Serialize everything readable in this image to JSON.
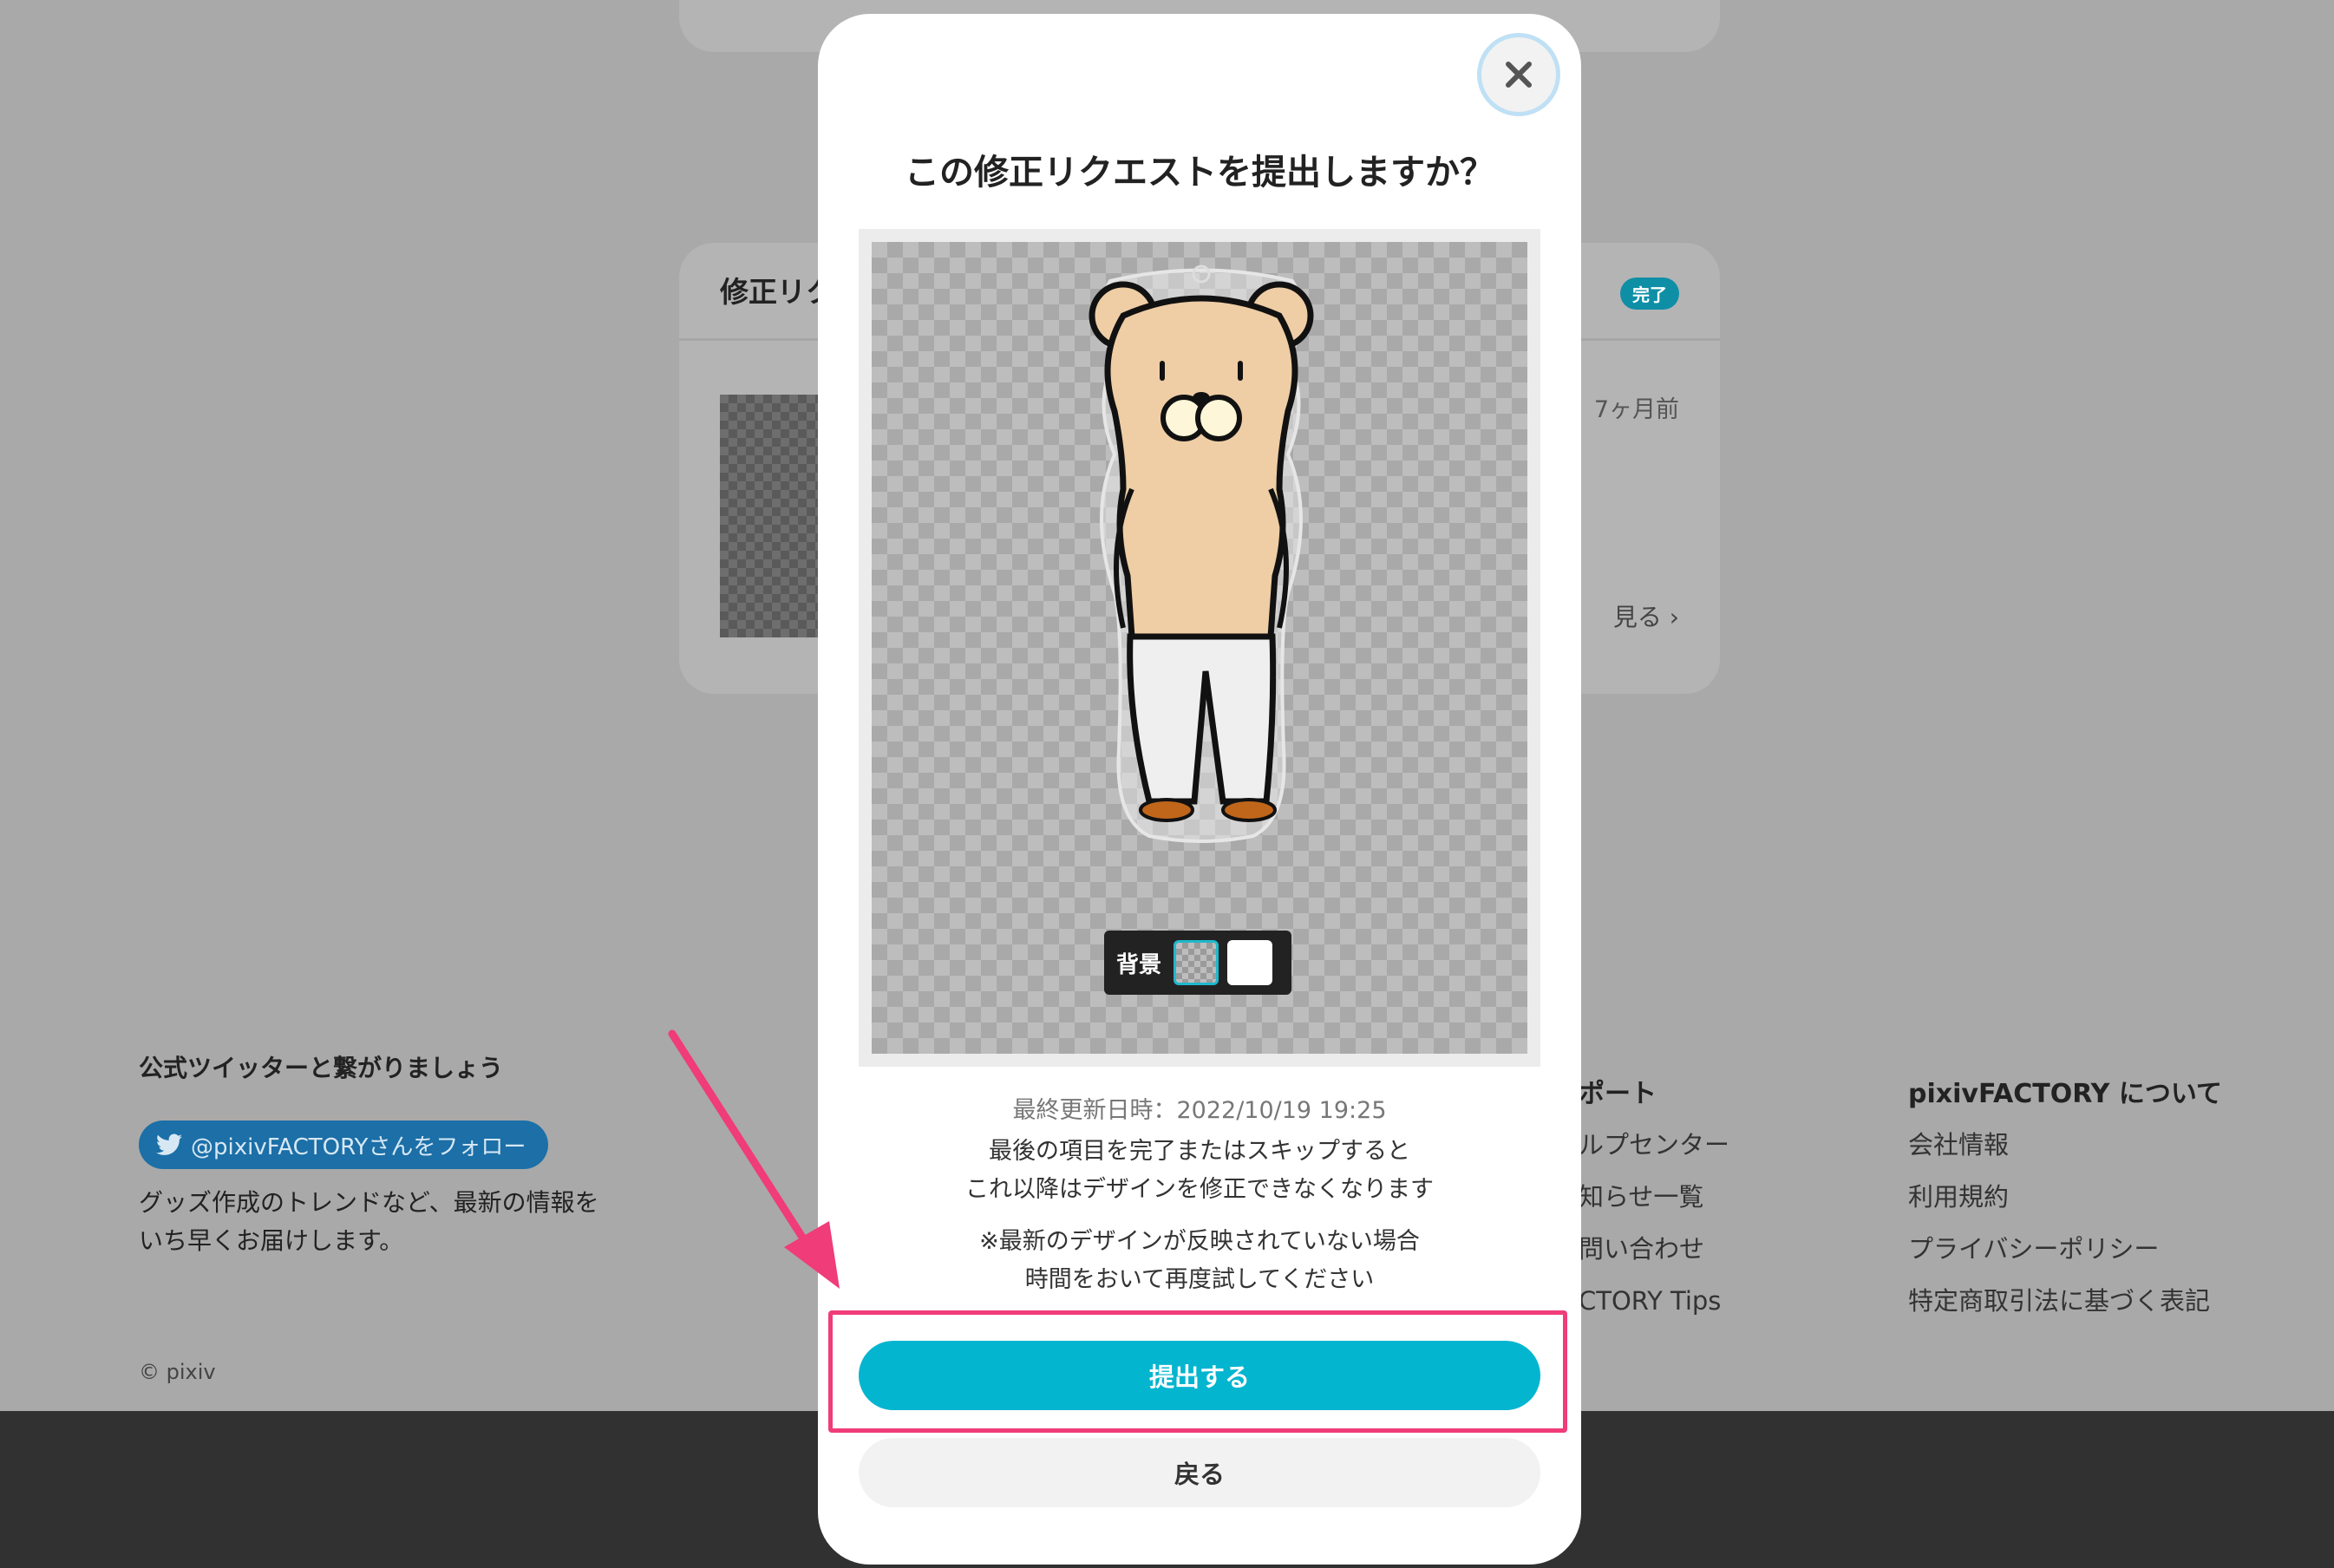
{
  "background": {
    "card_title": "修正リク",
    "badge": "完了",
    "time_ago": "7ヶ月前",
    "view_more": "見る",
    "footer": {
      "follow_title": "公式ツイッターと繋がりましょう",
      "follow_button": "@pixivFACTORYさんをフォロー",
      "desc_line1": "グッズ作成のトレンドなど、最新の情報を",
      "desc_line2": "いち早くお届けします。",
      "copyright": "© pixiv",
      "support_title": "ポート",
      "support_links": [
        "ルプセンター",
        "知らせ一覧",
        "問い合わせ",
        "CTORY Tips"
      ],
      "about_title": "pixivFACTORY について",
      "about_links": [
        "会社情報",
        "利用規約",
        "プライバシーポリシー",
        "特定商取引法に基づく表記"
      ]
    }
  },
  "modal": {
    "title": "この修正リクエストを提出しますか？",
    "background_toggle_label": "背景",
    "last_updated": "最終更新日時：2022/10/19 19:25",
    "notice_line1": "最後の項目を完了またはスキップすると",
    "notice_line2": "これ以降はデザインを修正できなくなります",
    "notice_line3": "※最新のデザインが反映されていない場合",
    "notice_line4": "時間をおいて再度試してください",
    "submit_button": "提出する",
    "back_button": "戻る"
  },
  "colors": {
    "accent": "#04b5cf",
    "annotation": "#f03c78",
    "overlay": "#a9a9a9"
  }
}
